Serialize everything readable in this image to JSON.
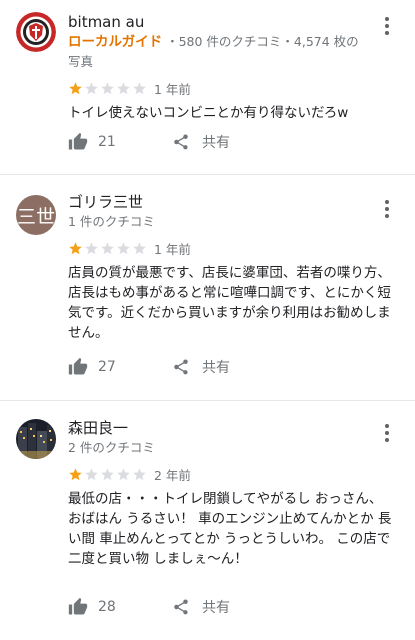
{
  "reviews": [
    {
      "author": "bitman au",
      "badge": "ローカルガイド",
      "stats": " ・580 件のクチコミ・4,574 枚の写真",
      "rating": 1,
      "date": "1 年前",
      "text": "トイレ使えないコンビニとか有り得ないだろw",
      "likes": "21",
      "share_label": "共有",
      "avatar_icon": "shield-crest-icon"
    },
    {
      "author": "ゴリラ三世",
      "avatar_text": "三世",
      "stats": "1 件のクチコミ",
      "rating": 1,
      "date": "1 年前",
      "text": "店員の質が最悪です、店長に婆軍団、若者の喋り方、店長はもめ事があると常に喧嘩口調です、とにかく短気です。近くだから買いますが余り利用はお勧めしません。",
      "likes": "27",
      "share_label": "共有"
    },
    {
      "author": "森田良一",
      "stats": "2 件のクチコミ",
      "rating": 1,
      "date": "2 年前",
      "text": "最低の店・・・トイレ閉鎖してやがるし おっさん、おばはん うるさい！ 車のエンジン止めてんかとか 長い間 車止めんとってとか うっとうしいわ。 この店で 二度と買い物 しましぇ〜ん！",
      "likes": "28",
      "share_label": "共有",
      "avatar_icon": "city-night-photo"
    }
  ],
  "colors": {
    "star_filled": "#f4a018",
    "star_empty": "#dadce0",
    "badge": "#e37400"
  }
}
